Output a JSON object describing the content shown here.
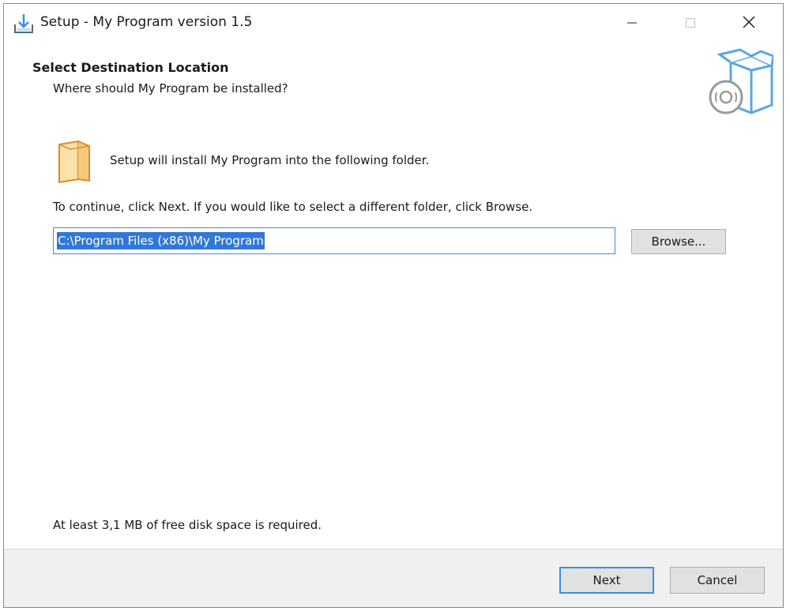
{
  "window": {
    "title": "Setup - My Program version 1.5",
    "icon": "setup-download-icon",
    "controls": [
      "minimize-icon",
      "maximize-icon",
      "close-icon"
    ]
  },
  "header": {
    "title": "Select Destination Location",
    "subtitle": "Where should My Program be installed?",
    "image": "install-box-cd-icon"
  },
  "body": {
    "folder_icon": "folder-icon",
    "info": "Setup will install My Program into the following folder.",
    "continue": "To continue, click Next. If you would like to select a different folder, click Browse.",
    "path_value": "C:\\Program Files (x86)\\My Program",
    "browse_label": "Browse...",
    "disk_space": "At least 3,1 MB of free disk space is required."
  },
  "footer": {
    "next_label": "Next",
    "cancel_label": "Cancel"
  },
  "colors": {
    "accent": "#3a8ee6",
    "selection": "#3078d8",
    "folder": "#f5c97a",
    "box": "#5aa7e0"
  }
}
